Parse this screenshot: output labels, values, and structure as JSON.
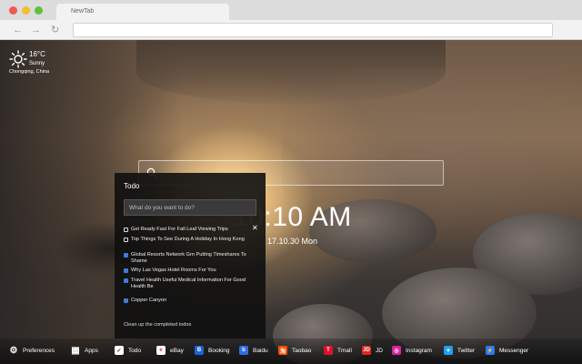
{
  "browser": {
    "tab_title": "NewTab"
  },
  "weather": {
    "temperature": "16°C",
    "condition": "Sunny",
    "location": "Chongqing, China"
  },
  "clock": {
    "time": "10:10 AM",
    "date": "17.10.30 Mon"
  },
  "todo": {
    "title": "Todo",
    "input_placeholder": "What do you want to do?",
    "items": [
      {
        "text": "Get Ready Fast For Fall Leaf Viewing Trips",
        "done": false
      },
      {
        "text": "Top Things To See During A Holiday In Hong Kong",
        "done": false
      },
      {
        "text": "Global Resorts Network Grn Putting Timeshares To Shame",
        "done": true
      },
      {
        "text": "Why Las Vegas Hotel Rooms For You",
        "done": true
      },
      {
        "text": "Travel Health Useful Medical Information For Good Health Be",
        "done": true
      },
      {
        "text": "Copper Canyon",
        "done": true
      }
    ],
    "clean_label": "Clean up the completed todos"
  },
  "bottom_bar": {
    "items": [
      {
        "label": "Preferences",
        "icon": "gear-icon",
        "color": "#ffffff"
      },
      {
        "label": "Apps",
        "icon": "grid-icon",
        "color": "#ffffff"
      },
      {
        "label": "Todo",
        "icon": "checkbox-icon",
        "color": "#ffffff"
      },
      {
        "label": "eBay",
        "icon": "ebay-icon",
        "color": "#ffffff"
      },
      {
        "label": "Booking",
        "icon": "booking-icon",
        "color": "#1e63d6"
      },
      {
        "label": "Baidu",
        "icon": "baidu-icon",
        "color": "#2e6ee6"
      },
      {
        "label": "Taobao",
        "icon": "taobao-icon",
        "color": "#ff5000"
      },
      {
        "label": "Tmall",
        "icon": "tmall-icon",
        "color": "#e0102a"
      },
      {
        "label": "JD",
        "icon": "jd-icon",
        "color": "#e1251b"
      },
      {
        "label": "Instagram",
        "icon": "instagram-icon",
        "color": "#d6249f"
      },
      {
        "label": "Twitter",
        "icon": "twitter-icon",
        "color": "#1da1f2"
      },
      {
        "label": "Messenger",
        "icon": "messenger-icon",
        "color": "#2a7bf6"
      }
    ]
  }
}
